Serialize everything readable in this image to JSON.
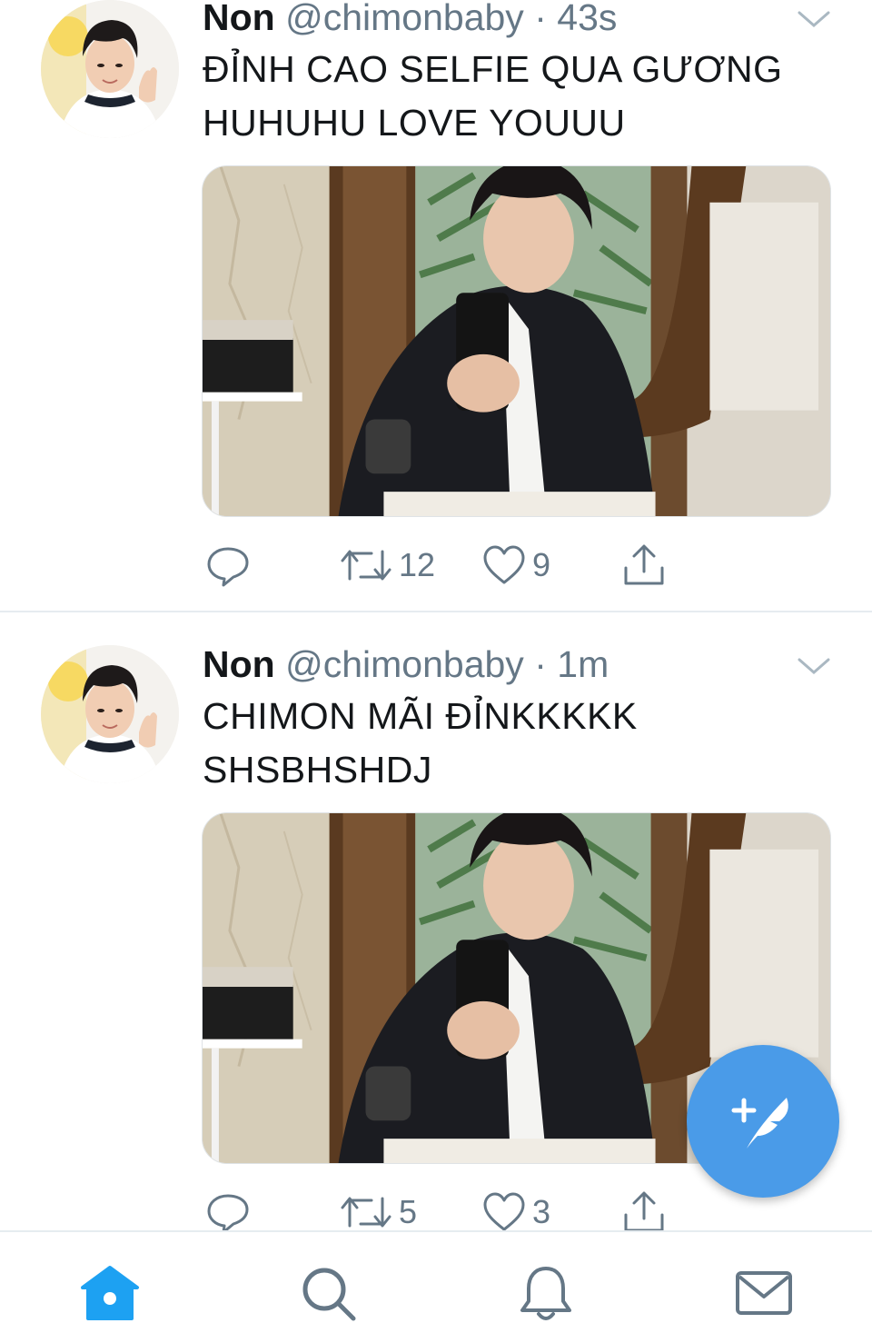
{
  "tweets": [
    {
      "name": "Non",
      "handle": "@chimonbaby",
      "separator": "·",
      "time": "43s",
      "text_lines": [
        "ĐỈNH CAO SELFIE QUA GƯƠNG",
        "HUHUHU LOVE YOUUU"
      ],
      "retweets": "12",
      "likes": "9"
    },
    {
      "name": "Non",
      "handle": "@chimonbaby",
      "separator": "·",
      "time": "1m",
      "text_lines": [
        "CHIMON MÃI ĐỈNKKKKK",
        "SHSBHSHDJ"
      ],
      "retweets": "5",
      "likes": "3"
    }
  ],
  "colors": {
    "accent": "#1da1f2",
    "fab": "#4a9be8",
    "secondary_text": "#657786",
    "primary_text": "#14171a",
    "divider": "#e6ecf0"
  },
  "icons": {
    "reply": "reply-icon",
    "retweet": "retweet-icon",
    "like": "heart-icon",
    "share": "share-icon",
    "more": "chevron-down-icon",
    "compose": "compose-tweet-icon",
    "tabs": [
      "home-icon",
      "search-icon",
      "bell-icon",
      "mail-icon"
    ]
  },
  "tabbar": {
    "active_tab": "home"
  }
}
